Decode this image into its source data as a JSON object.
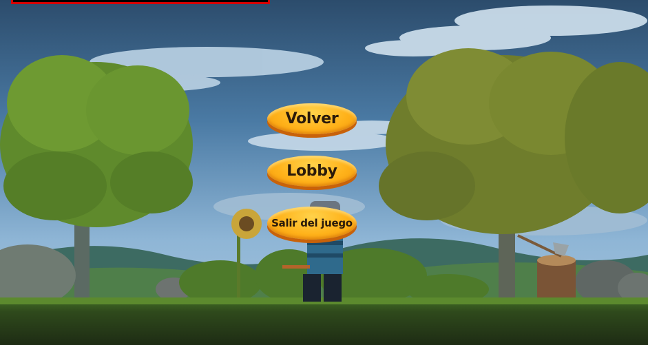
{
  "menu": {
    "resume_label": "Volver",
    "lobby_label": "Lobby",
    "exit_label": "Salir del juego"
  },
  "colors": {
    "button_fill": "#ffb21a",
    "button_shadow": "#c8620a",
    "health_bar_border": "#d40000"
  },
  "icons": {
    "player": "character-sprite",
    "tree": "tree-sprite",
    "stump_axe": "stump-with-axe-sprite",
    "sunflower": "sunflower-sprite"
  }
}
